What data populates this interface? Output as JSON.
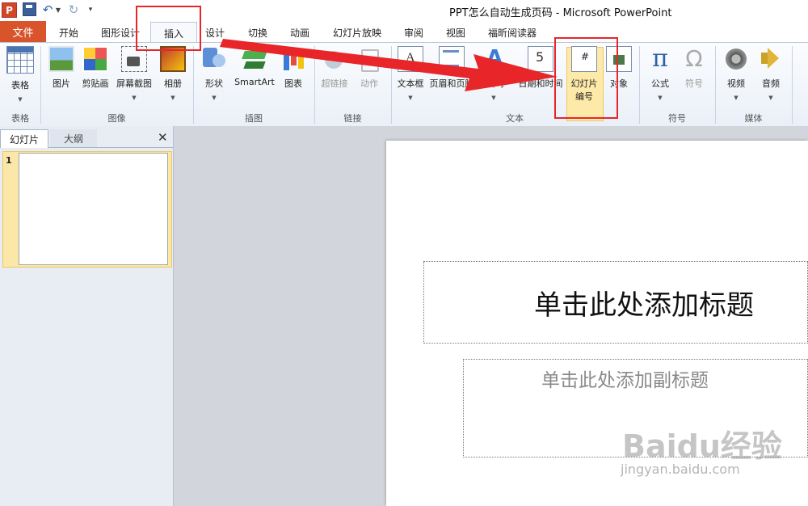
{
  "window_title": "PPT怎么自动生成页码 - Microsoft PowerPoint",
  "quick_access": {
    "app_logo": "P",
    "icons": [
      "powerpoint-logo-icon",
      "save-icon",
      "undo-icon",
      "redo-icon",
      "customize-toolbar-icon"
    ]
  },
  "tabs": {
    "file": "文件",
    "home": "开始",
    "graphic_design": "图形设计",
    "insert": "插入",
    "design": "设计",
    "transitions": "切换",
    "animations": "动画",
    "slideshow": "幻灯片放映",
    "review": "审阅",
    "view": "视图",
    "foxit_reader": "福昕阅读器",
    "active": "插入"
  },
  "ribbon": {
    "groups": {
      "tables": "表格",
      "images": "图像",
      "illustrations": "插图",
      "links": "链接",
      "text": "文本",
      "symbols": "符号",
      "media": "媒体"
    },
    "buttons": {
      "table": "表格",
      "picture": "图片",
      "clipart": "剪贴画",
      "screenshot": "屏幕截图",
      "album": "相册",
      "shapes": "形状",
      "smartart": "SmartArt",
      "chart": "图表",
      "hyperlink": "超链接",
      "action": "动作",
      "textbox": "文本框",
      "header_footer": "页眉和页脚",
      "wordart": "艺术字",
      "date_time": "日期和时间",
      "slide_number_line1": "幻灯片",
      "slide_number_line2": "编号",
      "object": "对象",
      "equation": "公式",
      "symbol": "符号",
      "video": "视频",
      "audio": "音频"
    },
    "highlighted_button": "幻灯片编号"
  },
  "left_pane": {
    "tab_slides": "幻灯片",
    "tab_outline": "大纲",
    "close": "✕",
    "thumbnail_number": "1"
  },
  "slide": {
    "title_placeholder": "单击此处添加标题",
    "subtitle_placeholder": "单击此处添加副标题"
  },
  "watermark": {
    "logo": "Baidu经验",
    "url": "jingyan.baidu.com"
  },
  "colors": {
    "file_tab": "#d9542b",
    "annotation": "#e8262a",
    "highlight": "#fde9a8"
  }
}
